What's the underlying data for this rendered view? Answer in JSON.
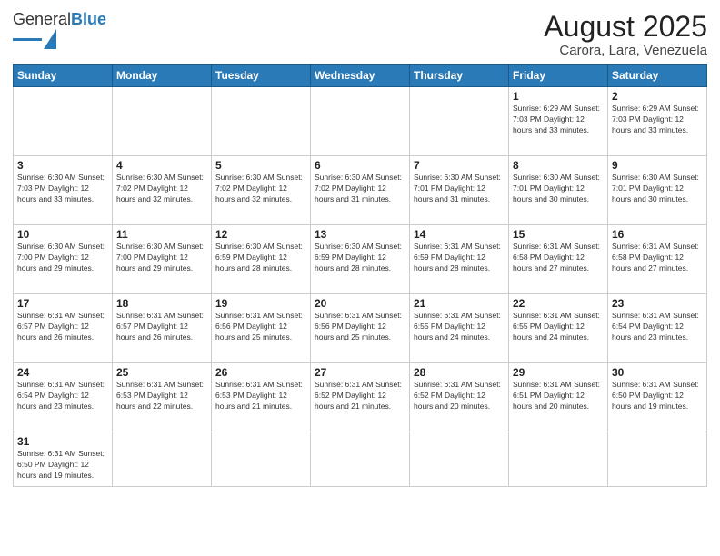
{
  "logo": {
    "text_general": "General",
    "text_blue": "Blue"
  },
  "header": {
    "title": "August 2025",
    "subtitle": "Carora, Lara, Venezuela"
  },
  "weekdays": [
    "Sunday",
    "Monday",
    "Tuesday",
    "Wednesday",
    "Thursday",
    "Friday",
    "Saturday"
  ],
  "weeks": [
    [
      {
        "day": "",
        "info": ""
      },
      {
        "day": "",
        "info": ""
      },
      {
        "day": "",
        "info": ""
      },
      {
        "day": "",
        "info": ""
      },
      {
        "day": "",
        "info": ""
      },
      {
        "day": "1",
        "info": "Sunrise: 6:29 AM\nSunset: 7:03 PM\nDaylight: 12 hours\nand 33 minutes."
      },
      {
        "day": "2",
        "info": "Sunrise: 6:29 AM\nSunset: 7:03 PM\nDaylight: 12 hours\nand 33 minutes."
      }
    ],
    [
      {
        "day": "3",
        "info": "Sunrise: 6:30 AM\nSunset: 7:03 PM\nDaylight: 12 hours\nand 33 minutes."
      },
      {
        "day": "4",
        "info": "Sunrise: 6:30 AM\nSunset: 7:02 PM\nDaylight: 12 hours\nand 32 minutes."
      },
      {
        "day": "5",
        "info": "Sunrise: 6:30 AM\nSunset: 7:02 PM\nDaylight: 12 hours\nand 32 minutes."
      },
      {
        "day": "6",
        "info": "Sunrise: 6:30 AM\nSunset: 7:02 PM\nDaylight: 12 hours\nand 31 minutes."
      },
      {
        "day": "7",
        "info": "Sunrise: 6:30 AM\nSunset: 7:01 PM\nDaylight: 12 hours\nand 31 minutes."
      },
      {
        "day": "8",
        "info": "Sunrise: 6:30 AM\nSunset: 7:01 PM\nDaylight: 12 hours\nand 30 minutes."
      },
      {
        "day": "9",
        "info": "Sunrise: 6:30 AM\nSunset: 7:01 PM\nDaylight: 12 hours\nand 30 minutes."
      }
    ],
    [
      {
        "day": "10",
        "info": "Sunrise: 6:30 AM\nSunset: 7:00 PM\nDaylight: 12 hours\nand 29 minutes."
      },
      {
        "day": "11",
        "info": "Sunrise: 6:30 AM\nSunset: 7:00 PM\nDaylight: 12 hours\nand 29 minutes."
      },
      {
        "day": "12",
        "info": "Sunrise: 6:30 AM\nSunset: 6:59 PM\nDaylight: 12 hours\nand 28 minutes."
      },
      {
        "day": "13",
        "info": "Sunrise: 6:30 AM\nSunset: 6:59 PM\nDaylight: 12 hours\nand 28 minutes."
      },
      {
        "day": "14",
        "info": "Sunrise: 6:31 AM\nSunset: 6:59 PM\nDaylight: 12 hours\nand 28 minutes."
      },
      {
        "day": "15",
        "info": "Sunrise: 6:31 AM\nSunset: 6:58 PM\nDaylight: 12 hours\nand 27 minutes."
      },
      {
        "day": "16",
        "info": "Sunrise: 6:31 AM\nSunset: 6:58 PM\nDaylight: 12 hours\nand 27 minutes."
      }
    ],
    [
      {
        "day": "17",
        "info": "Sunrise: 6:31 AM\nSunset: 6:57 PM\nDaylight: 12 hours\nand 26 minutes."
      },
      {
        "day": "18",
        "info": "Sunrise: 6:31 AM\nSunset: 6:57 PM\nDaylight: 12 hours\nand 26 minutes."
      },
      {
        "day": "19",
        "info": "Sunrise: 6:31 AM\nSunset: 6:56 PM\nDaylight: 12 hours\nand 25 minutes."
      },
      {
        "day": "20",
        "info": "Sunrise: 6:31 AM\nSunset: 6:56 PM\nDaylight: 12 hours\nand 25 minutes."
      },
      {
        "day": "21",
        "info": "Sunrise: 6:31 AM\nSunset: 6:55 PM\nDaylight: 12 hours\nand 24 minutes."
      },
      {
        "day": "22",
        "info": "Sunrise: 6:31 AM\nSunset: 6:55 PM\nDaylight: 12 hours\nand 24 minutes."
      },
      {
        "day": "23",
        "info": "Sunrise: 6:31 AM\nSunset: 6:54 PM\nDaylight: 12 hours\nand 23 minutes."
      }
    ],
    [
      {
        "day": "24",
        "info": "Sunrise: 6:31 AM\nSunset: 6:54 PM\nDaylight: 12 hours\nand 23 minutes."
      },
      {
        "day": "25",
        "info": "Sunrise: 6:31 AM\nSunset: 6:53 PM\nDaylight: 12 hours\nand 22 minutes."
      },
      {
        "day": "26",
        "info": "Sunrise: 6:31 AM\nSunset: 6:53 PM\nDaylight: 12 hours\nand 21 minutes."
      },
      {
        "day": "27",
        "info": "Sunrise: 6:31 AM\nSunset: 6:52 PM\nDaylight: 12 hours\nand 21 minutes."
      },
      {
        "day": "28",
        "info": "Sunrise: 6:31 AM\nSunset: 6:52 PM\nDaylight: 12 hours\nand 20 minutes."
      },
      {
        "day": "29",
        "info": "Sunrise: 6:31 AM\nSunset: 6:51 PM\nDaylight: 12 hours\nand 20 minutes."
      },
      {
        "day": "30",
        "info": "Sunrise: 6:31 AM\nSunset: 6:50 PM\nDaylight: 12 hours\nand 19 minutes."
      }
    ],
    [
      {
        "day": "31",
        "info": "Sunrise: 6:31 AM\nSunset: 6:50 PM\nDaylight: 12 hours\nand 19 minutes."
      },
      {
        "day": "",
        "info": ""
      },
      {
        "day": "",
        "info": ""
      },
      {
        "day": "",
        "info": ""
      },
      {
        "day": "",
        "info": ""
      },
      {
        "day": "",
        "info": ""
      },
      {
        "day": "",
        "info": ""
      }
    ]
  ]
}
